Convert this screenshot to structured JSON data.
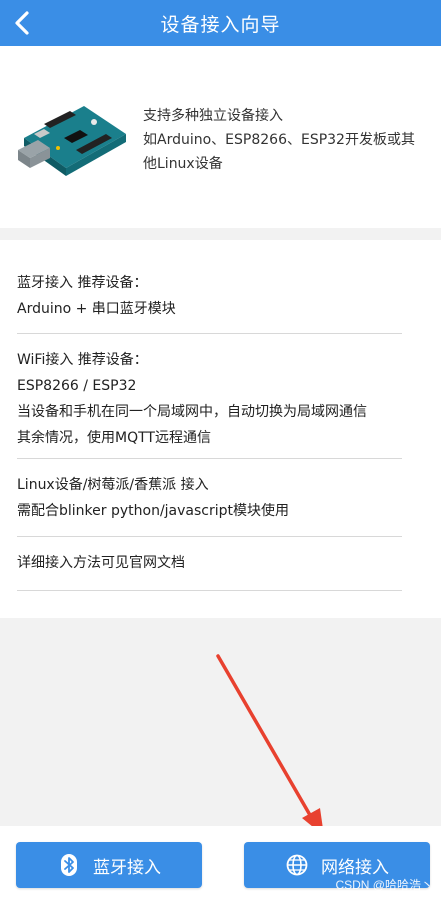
{
  "header": {
    "title": "设备接入向导"
  },
  "intro": {
    "line1": "支持多种独立设备接入",
    "line2": "如Arduino、ESP8266、ESP32开发板或其",
    "line3": "他Linux设备"
  },
  "info": {
    "bt_title": "蓝牙接入 推荐设备：",
    "bt_device": "Arduino + 串口蓝牙模块",
    "wifi_title": "WiFi接入 推荐设备：",
    "wifi_device": "ESP8266 / ESP32",
    "wifi_note1": "当设备和手机在同一个局域网中，自动切换为局域网通信",
    "wifi_note2": "其余情况，使用MQTT远程通信",
    "linux_title": "Linux设备/树莓派/香蕉派 接入",
    "linux_note": "需配合blinker python/javascript模块使用",
    "docs": "详细接入方法可见官网文档"
  },
  "buttons": {
    "bluetooth": "蓝牙接入",
    "network": "网络接入"
  },
  "watermark": "CSDN @哈哈浩丶",
  "colors": {
    "accent": "#3a8ee6",
    "arrow": "#e8412f"
  }
}
